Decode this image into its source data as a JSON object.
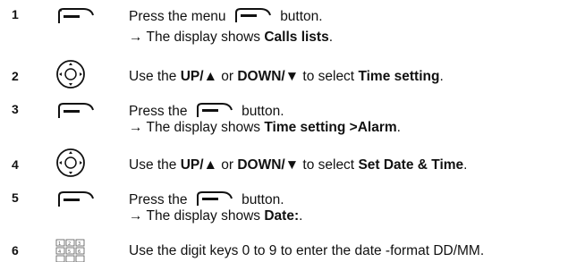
{
  "steps": [
    {
      "number": "1",
      "icon": "menu-button-icon",
      "line1": {
        "before": "Press the menu",
        "after": "button."
      },
      "line2": {
        "prefix": "→ The display shows",
        "bold": "Calls lists",
        "suffix": "."
      }
    },
    {
      "number": "2",
      "icon": "navigation-key-icon",
      "line1": {
        "t1": "Use the",
        "b1": "UP/▲",
        "t2": "or",
        "b2": "DOWN/▼",
        "t3": "to select",
        "b3": "Time setting",
        "t4": "."
      }
    },
    {
      "number": "3",
      "icon": "menu-button-icon",
      "line1": {
        "before": "Press the",
        "after": "button."
      },
      "line2": {
        "prefix": "→ The display shows",
        "bold": "Time setting >Alarm",
        "suffix": "."
      }
    },
    {
      "number": "4",
      "icon": "navigation-key-icon",
      "line1": {
        "t1": "Use the",
        "b1": "UP/▲",
        "t2": "or",
        "b2": "DOWN/▼",
        "t3": "to select",
        "b3": "Set Date & Time",
        "t4": "."
      }
    },
    {
      "number": "5",
      "icon": "menu-button-icon",
      "line1": {
        "before": "Press the",
        "after": "button."
      },
      "line2": {
        "prefix": "→ The display shows",
        "bold": "Date:",
        "suffix": "."
      }
    },
    {
      "number": "6",
      "icon": "digit-keypad-icon",
      "line1": {
        "text": "Use the digit keys 0 to 9 to enter the date -format DD/MM."
      }
    }
  ]
}
